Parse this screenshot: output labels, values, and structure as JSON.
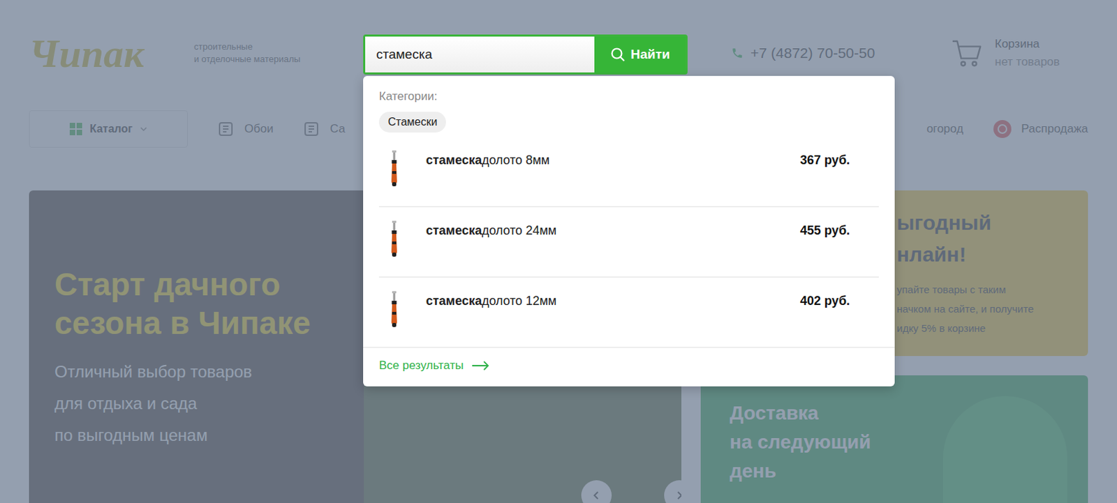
{
  "header": {
    "logo": "Чипак",
    "tagline": [
      "строительные",
      "и отделочные материалы"
    ],
    "phone": "+7 (4872) 70-50-50",
    "cart": {
      "title": "Корзина",
      "status": "нет товаров"
    }
  },
  "nav": {
    "catalog": "Каталог",
    "items_left": [
      {
        "label": "Обои"
      },
      {
        "label": "Са"
      }
    ],
    "items_right": [
      {
        "label": "огород"
      },
      {
        "label": "Распродажа"
      }
    ]
  },
  "banner": {
    "title": [
      "Старт дачного",
      "сезона в Чипаке"
    ],
    "subtitle": [
      "Отличный выбор товаров",
      "для отдыха и сада",
      "по выгодным ценам"
    ]
  },
  "promo": {
    "title": [
      "ыгодный",
      "нлайн!"
    ],
    "text": [
      "упайте товары с таким",
      "начком на сайте, и получите",
      "идку 5% в корзине"
    ]
  },
  "delivery": {
    "title": [
      "Доставка",
      "на следующий",
      "день"
    ]
  },
  "search": {
    "query": "стамеска",
    "button": "Найти",
    "categories_label": "Категории:",
    "categories": [
      "Стамески"
    ],
    "results": [
      {
        "match": "стамеска",
        "rest": "долото 8мм",
        "price": "367 руб."
      },
      {
        "match": "стамеска",
        "rest": "долото 24мм",
        "price": "455 руб."
      },
      {
        "match": "стамеска",
        "rest": "долото 12мм",
        "price": "402 руб."
      }
    ],
    "all_results": "Все результаты"
  }
}
